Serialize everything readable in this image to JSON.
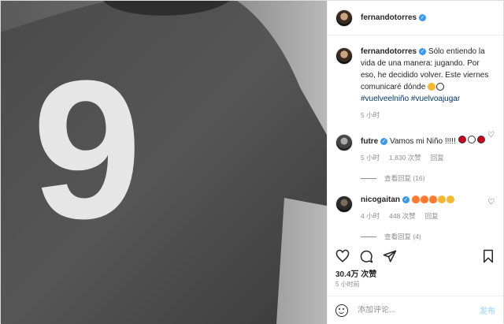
{
  "author": {
    "username": "fernandotorres",
    "verified": true
  },
  "photo": {
    "jersey_number": "9"
  },
  "caption": {
    "username": "fernandotorres",
    "text": "Sólo entiendo la vida de una manera: jugando. Por eso, he decidido volver. Este viernes comunicaré dónde",
    "hashtags": "#vuelveelniño #vuelvoajugar",
    "time": "5 小时"
  },
  "comments": [
    {
      "username": "futre",
      "verified": true,
      "text": "Vamos mi Niño !!!!!",
      "time": "5 小时",
      "likes": "1,830 次赞",
      "reply_label": "回复",
      "view_replies": "查看回复 (16)"
    },
    {
      "username": "nicogaitan",
      "verified": true,
      "time": "4 小时",
      "likes": "448 次赞",
      "reply_label": "回复",
      "view_replies": "查看回复 (4)"
    }
  ],
  "icons": {
    "like": "heart-icon",
    "comment": "comment-icon",
    "share": "share-icon",
    "save": "bookmark-icon",
    "emoji": "emoji-icon"
  },
  "stats": {
    "likes": "30.4万 次赞",
    "posted": "5 小时前"
  },
  "composer": {
    "placeholder": "添加评论...",
    "post_label": "发布"
  },
  "colors": {
    "link": "#00376b",
    "verified": "#3897f0",
    "muted": "#8e8e8e",
    "post_disabled": "#b2dffc"
  }
}
